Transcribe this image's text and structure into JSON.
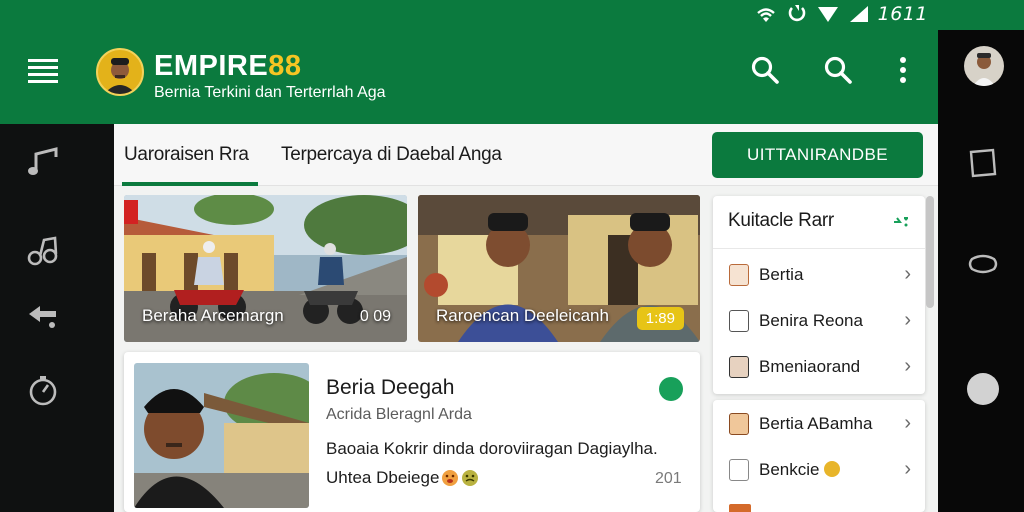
{
  "status_bar": {
    "time": "1611",
    "icons": [
      "wifi-icon",
      "rotate-icon",
      "signal-icon",
      "signal-icon"
    ]
  },
  "left_rail": {
    "items": [
      {
        "icon": "menu-icon"
      },
      {
        "icon": "music-note-icon"
      },
      {
        "icon": "music-notes-icon"
      },
      {
        "icon": "share-icon"
      },
      {
        "icon": "timer-icon"
      }
    ]
  },
  "header": {
    "brand_main": "EMPIRE",
    "brand_accent": "88",
    "tagline": "Bernia Terkini dan Terterrlah Aga",
    "actions": [
      "search-icon",
      "search-icon",
      "more-vertical-icon"
    ]
  },
  "tabs": [
    {
      "label": "Uaroraisen Rra",
      "active": true
    },
    {
      "label": "Terpercaya di Daebal Anga",
      "active": false
    }
  ],
  "cta": {
    "label": "UITTANIRANDBE"
  },
  "photo_cards": [
    {
      "caption": "Beraha Arcemargn",
      "meta": "0 09"
    },
    {
      "caption": "Raroencan Deeleicanh",
      "badge": "1:89"
    }
  ],
  "feature": {
    "title": "Beria Deegah",
    "subtitle": "Acrida Bleragnl Arda",
    "body": "Baoaia Kokrir dinda doroviiragan Dagiaylha.",
    "footer": "Uhtea Dbeiege",
    "count": "201"
  },
  "side_panel": {
    "title": "Kuitacle Rarr",
    "rows_top": [
      {
        "label": "Bertia"
      },
      {
        "label": "Benira Reona"
      },
      {
        "label": "Bmeniaorand"
      }
    ],
    "rows_bottom": [
      {
        "label": "Bertia ABamha"
      },
      {
        "label": "Benkcie"
      }
    ]
  },
  "colors": {
    "brand_green": "#0b7a3e",
    "accent_yellow": "#f5c523",
    "badge_yellow": "#e7c416"
  }
}
